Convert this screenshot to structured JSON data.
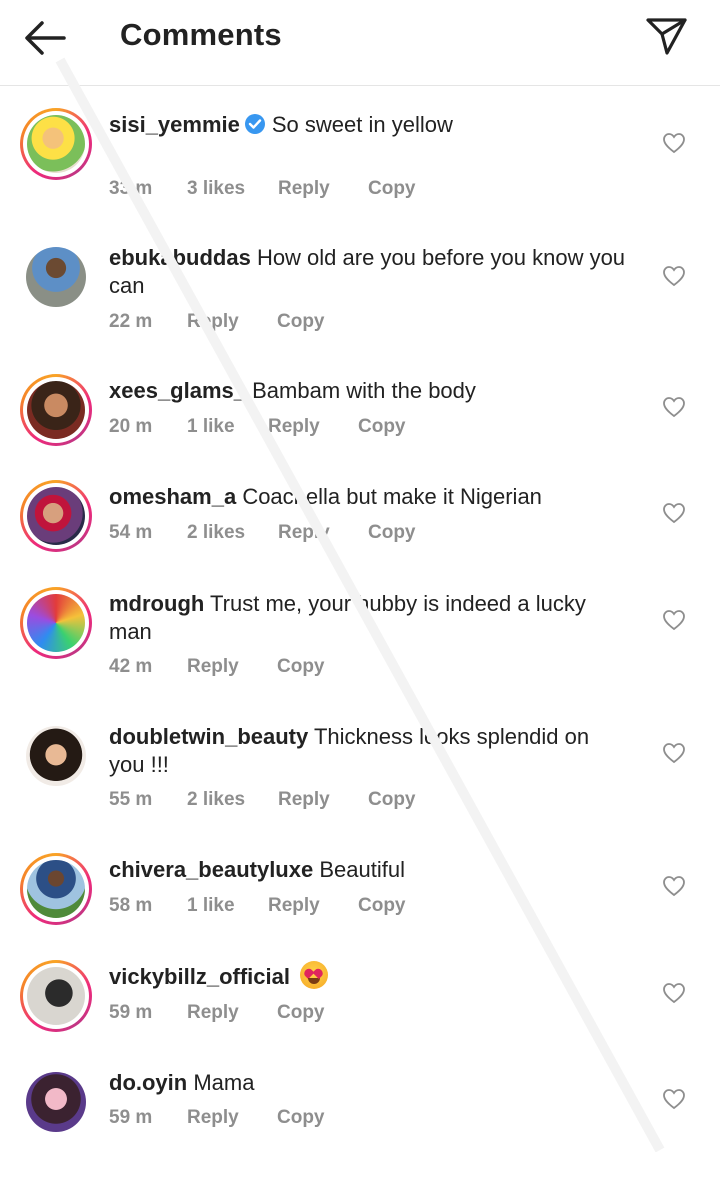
{
  "header": {
    "title": "Comments",
    "back_icon": "arrow-left-icon",
    "send_icon": "paper-plane-icon"
  },
  "comments": [
    {
      "username": "sisi_yemmie",
      "verified": true,
      "text": "So sweet in yellow",
      "time": "3‌3 m",
      "likes": "3 likes",
      "reply": "Reply",
      "copy": "Copy"
    },
    {
      "username": "ebukabuddas",
      "verified": false,
      "text": "How old are you before you know you can",
      "time": "22 m",
      "likes": "",
      "reply": "Reply",
      "copy": "Copy"
    },
    {
      "username": "xees_glams_",
      "verified": false,
      "text": "Bambam with the body",
      "time": "20 m",
      "likes": "1 like",
      "reply": "Reply",
      "copy": "Copy"
    },
    {
      "username": "omesham_a",
      "verified": false,
      "text": "Coachella but make it Nigerian",
      "time": "54 m",
      "likes": "2 likes",
      "reply": "Reply",
      "copy": "Copy"
    },
    {
      "username": "mdrough",
      "verified": false,
      "text": "Trust me, your hubby is indeed a lucky man",
      "time": "42 m",
      "likes": "",
      "reply": "Reply",
      "copy": "Copy"
    },
    {
      "username": "doubletwin_beauty",
      "verified": false,
      "text": "Thickness looks splendid on you !!!",
      "time": "55 m",
      "likes": "2 likes",
      "reply": "Reply",
      "copy": "Copy"
    },
    {
      "username": "chivera_beautyluxe",
      "verified": false,
      "text": "Beautiful",
      "time": "58 m",
      "likes": "1 like",
      "reply": "Reply",
      "copy": "Copy"
    },
    {
      "username": "vickybillz_official",
      "verified": false,
      "text": "",
      "emoji": "heart-eyes-emoji",
      "time": "59 m",
      "likes": "",
      "reply": "Reply",
      "copy": "Copy"
    },
    {
      "username": "do.oyin",
      "verified": false,
      "text": "Mama",
      "time": "59 m",
      "likes": "",
      "reply": "Reply",
      "copy": "Copy"
    }
  ],
  "colors": {
    "verified_badge": "#3897f0",
    "meta_text": "#8e8e8e",
    "story_ring_start": "#f9a426",
    "story_ring_end": "#c13584"
  }
}
